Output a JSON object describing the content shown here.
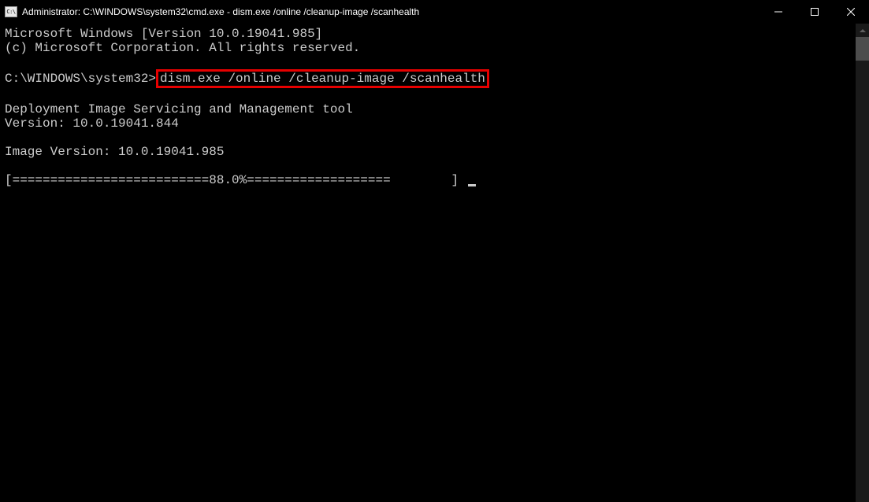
{
  "titlebar": {
    "title": "Administrator: C:\\WINDOWS\\system32\\cmd.exe - dism.exe  /online /cleanup-image /scanhealth"
  },
  "terminal": {
    "line1": "Microsoft Windows [Version 10.0.19041.985]",
    "line2": "(c) Microsoft Corporation. All rights reserved.",
    "prompt_prefix": "C:\\WINDOWS\\system32>",
    "command": "dism.exe /online /cleanup-image /scanhealth",
    "tool_name": "Deployment Image Servicing and Management tool",
    "tool_version": "Version: 10.0.19041.844",
    "image_version": "Image Version: 10.0.19041.985",
    "progress": "[==========================88.0%===================        ] "
  }
}
